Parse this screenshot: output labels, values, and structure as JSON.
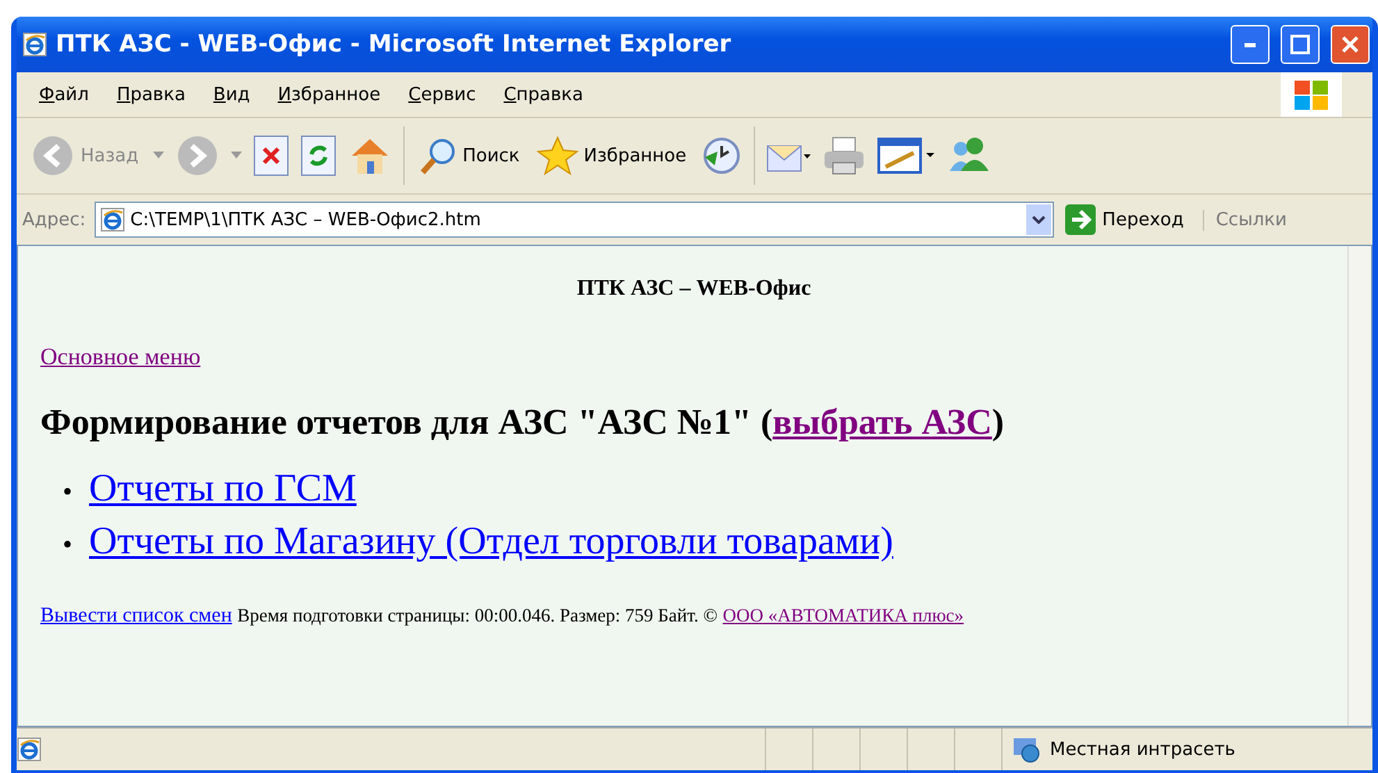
{
  "window": {
    "title": "ПТК АЗС - WEB-Офис - Microsoft Internet Explorer"
  },
  "menu": [
    {
      "label": "Файл"
    },
    {
      "label": "Правка"
    },
    {
      "label": "Вид"
    },
    {
      "label": "Избранное"
    },
    {
      "label": "Сервис"
    },
    {
      "label": "Справка"
    }
  ],
  "toolbar": {
    "back": {
      "label": "Назад",
      "disabled": true
    },
    "search": {
      "label": "Поиск"
    },
    "favorites": {
      "label": "Избранное"
    }
  },
  "address": {
    "label": "Адрес:",
    "value": "C:\\TEMP\\1\\ПТК АЗС – WEB-Офис2.htm",
    "go": "Переход",
    "links": "Ссылки"
  },
  "page": {
    "header": "ПТК АЗС – WEB-Офис",
    "main_menu": {
      "text": "Основное меню",
      "visited": true
    },
    "heading": {
      "text": "Формирование отчетов для АЗС \"АЗС №1\" (",
      "link": {
        "text": "выбрать АЗС",
        "visited": true
      },
      "after": ")"
    },
    "items": [
      {
        "marker": "•",
        "text": "Отчеты по ГСМ",
        "visited": false
      },
      {
        "marker": "•",
        "text": "Отчеты по Магазину (Отдел торговли товарами)",
        "visited": false
      }
    ],
    "footer": {
      "shifts": {
        "text": "Вывести список смен",
        "visited": false
      },
      "info": "Время подготовки страницы: 00:00.046. Размер: 759 Байт. ©",
      "company": {
        "text": "ООО «АВТОМАТИКА плюс»",
        "visited": true
      }
    }
  },
  "status_bar": {
    "zone": "Местная интрасеть"
  }
}
